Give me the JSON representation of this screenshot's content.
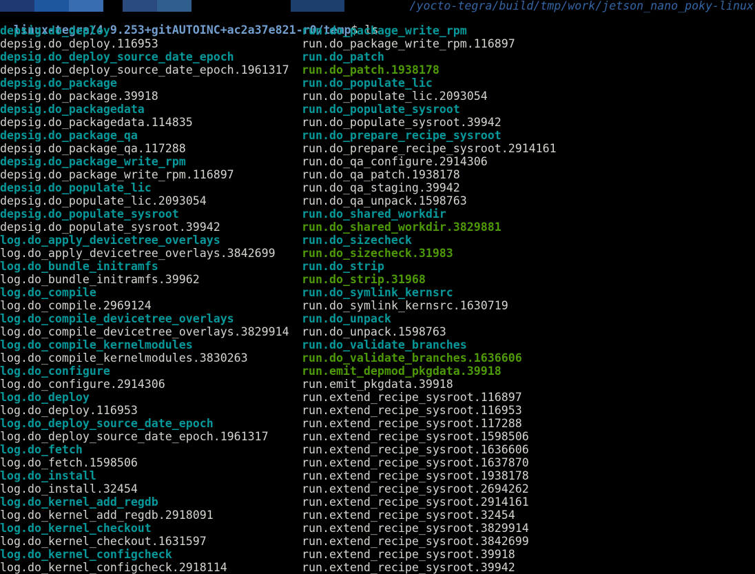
{
  "title_path": "/yocto-tegra/build/tmp/work/jetson_nano_poky-linux",
  "colors": {
    "background": "#000000",
    "text": "#d3d7cf",
    "dir": "#06989a",
    "exe": "#4e9a06",
    "prompt_path": "#729fcf",
    "title": "#3465a4",
    "tab_colors": [
      "#1f3a73",
      "#1e56a0",
      "#3a6cb0",
      "#2a4a80",
      "#2f5f8f",
      "#1c3f6e"
    ]
  },
  "prompt": {
    "path": "linux-tegra/4.9.253+gitAUTOINC+ac2a37e821-r0/temp",
    "symbol": "$ ",
    "command": "ls"
  },
  "left_column": [
    {
      "name": "depsig.do_deploy",
      "type": "dir"
    },
    {
      "name": "depsig.do_deploy.116953",
      "type": "file"
    },
    {
      "name": "depsig.do_deploy_source_date_epoch",
      "type": "dir"
    },
    {
      "name": "depsig.do_deploy_source_date_epoch.1961317",
      "type": "file"
    },
    {
      "name": "depsig.do_package",
      "type": "dir"
    },
    {
      "name": "depsig.do_package.39918",
      "type": "file"
    },
    {
      "name": "depsig.do_packagedata",
      "type": "dir"
    },
    {
      "name": "depsig.do_packagedata.114835",
      "type": "file"
    },
    {
      "name": "depsig.do_package_qa",
      "type": "dir"
    },
    {
      "name": "depsig.do_package_qa.117288",
      "type": "file"
    },
    {
      "name": "depsig.do_package_write_rpm",
      "type": "dir"
    },
    {
      "name": "depsig.do_package_write_rpm.116897",
      "type": "file"
    },
    {
      "name": "depsig.do_populate_lic",
      "type": "dir"
    },
    {
      "name": "depsig.do_populate_lic.2093054",
      "type": "file"
    },
    {
      "name": "depsig.do_populate_sysroot",
      "type": "dir"
    },
    {
      "name": "depsig.do_populate_sysroot.39942",
      "type": "file"
    },
    {
      "name": "log.do_apply_devicetree_overlays",
      "type": "dir"
    },
    {
      "name": "log.do_apply_devicetree_overlays.3842699",
      "type": "file"
    },
    {
      "name": "log.do_bundle_initramfs",
      "type": "dir"
    },
    {
      "name": "log.do_bundle_initramfs.39962",
      "type": "file"
    },
    {
      "name": "log.do_compile",
      "type": "dir"
    },
    {
      "name": "log.do_compile.2969124",
      "type": "file"
    },
    {
      "name": "log.do_compile_devicetree_overlays",
      "type": "dir"
    },
    {
      "name": "log.do_compile_devicetree_overlays.3829914",
      "type": "file"
    },
    {
      "name": "log.do_compile_kernelmodules",
      "type": "dir"
    },
    {
      "name": "log.do_compile_kernelmodules.3830263",
      "type": "file"
    },
    {
      "name": "log.do_configure",
      "type": "dir"
    },
    {
      "name": "log.do_configure.2914306",
      "type": "file"
    },
    {
      "name": "log.do_deploy",
      "type": "dir"
    },
    {
      "name": "log.do_deploy.116953",
      "type": "file"
    },
    {
      "name": "log.do_deploy_source_date_epoch",
      "type": "dir"
    },
    {
      "name": "log.do_deploy_source_date_epoch.1961317",
      "type": "file"
    },
    {
      "name": "log.do_fetch",
      "type": "dir"
    },
    {
      "name": "log.do_fetch.1598506",
      "type": "file"
    },
    {
      "name": "log.do_install",
      "type": "dir"
    },
    {
      "name": "log.do_install.32454",
      "type": "file"
    },
    {
      "name": "log.do_kernel_add_regdb",
      "type": "dir"
    },
    {
      "name": "log.do_kernel_add_regdb.2918091",
      "type": "file"
    },
    {
      "name": "log.do_kernel_checkout",
      "type": "dir"
    },
    {
      "name": "log.do_kernel_checkout.1631597",
      "type": "file"
    },
    {
      "name": "log.do_kernel_configcheck",
      "type": "dir"
    },
    {
      "name": "log.do_kernel_configcheck.2918114",
      "type": "file"
    }
  ],
  "right_column": [
    {
      "name": "run.do_package_write_rpm",
      "type": "dir"
    },
    {
      "name": "run.do_package_write_rpm.116897",
      "type": "file"
    },
    {
      "name": "run.do_patch",
      "type": "dir"
    },
    {
      "name": "run.do_patch.1938178",
      "type": "exe"
    },
    {
      "name": "run.do_populate_lic",
      "type": "dir"
    },
    {
      "name": "run.do_populate_lic.2093054",
      "type": "file"
    },
    {
      "name": "run.do_populate_sysroot",
      "type": "dir"
    },
    {
      "name": "run.do_populate_sysroot.39942",
      "type": "file"
    },
    {
      "name": "run.do_prepare_recipe_sysroot",
      "type": "dir"
    },
    {
      "name": "run.do_prepare_recipe_sysroot.2914161",
      "type": "file"
    },
    {
      "name": "run.do_qa_configure.2914306",
      "type": "file"
    },
    {
      "name": "run.do_qa_patch.1938178",
      "type": "file"
    },
    {
      "name": "run.do_qa_staging.39942",
      "type": "file"
    },
    {
      "name": "run.do_qa_unpack.1598763",
      "type": "file"
    },
    {
      "name": "run.do_shared_workdir",
      "type": "dir"
    },
    {
      "name": "run.do_shared_workdir.3829881",
      "type": "exe"
    },
    {
      "name": "run.do_sizecheck",
      "type": "dir"
    },
    {
      "name": "run.do_sizecheck.31983",
      "type": "exe"
    },
    {
      "name": "run.do_strip",
      "type": "dir"
    },
    {
      "name": "run.do_strip.31968",
      "type": "exe"
    },
    {
      "name": "run.do_symlink_kernsrc",
      "type": "dir"
    },
    {
      "name": "run.do_symlink_kernsrc.1630719",
      "type": "file"
    },
    {
      "name": "run.do_unpack",
      "type": "dir"
    },
    {
      "name": "run.do_unpack.1598763",
      "type": "file"
    },
    {
      "name": "run.do_validate_branches",
      "type": "dir"
    },
    {
      "name": "run.do_validate_branches.1636606",
      "type": "exe"
    },
    {
      "name": "run.emit_depmod_pkgdata.39918",
      "type": "exe"
    },
    {
      "name": "run.emit_pkgdata.39918",
      "type": "file"
    },
    {
      "name": "run.extend_recipe_sysroot.116897",
      "type": "file"
    },
    {
      "name": "run.extend_recipe_sysroot.116953",
      "type": "file"
    },
    {
      "name": "run.extend_recipe_sysroot.117288",
      "type": "file"
    },
    {
      "name": "run.extend_recipe_sysroot.1598506",
      "type": "file"
    },
    {
      "name": "run.extend_recipe_sysroot.1636606",
      "type": "file"
    },
    {
      "name": "run.extend_recipe_sysroot.1637870",
      "type": "file"
    },
    {
      "name": "run.extend_recipe_sysroot.1938178",
      "type": "file"
    },
    {
      "name": "run.extend_recipe_sysroot.2694262",
      "type": "file"
    },
    {
      "name": "run.extend_recipe_sysroot.2914161",
      "type": "file"
    },
    {
      "name": "run.extend_recipe_sysroot.32454",
      "type": "file"
    },
    {
      "name": "run.extend_recipe_sysroot.3829914",
      "type": "file"
    },
    {
      "name": "run.extend_recipe_sysroot.3842699",
      "type": "file"
    },
    {
      "name": "run.extend_recipe_sysroot.39918",
      "type": "file"
    },
    {
      "name": "run.extend_recipe_sysroot.39942",
      "type": "file"
    }
  ]
}
